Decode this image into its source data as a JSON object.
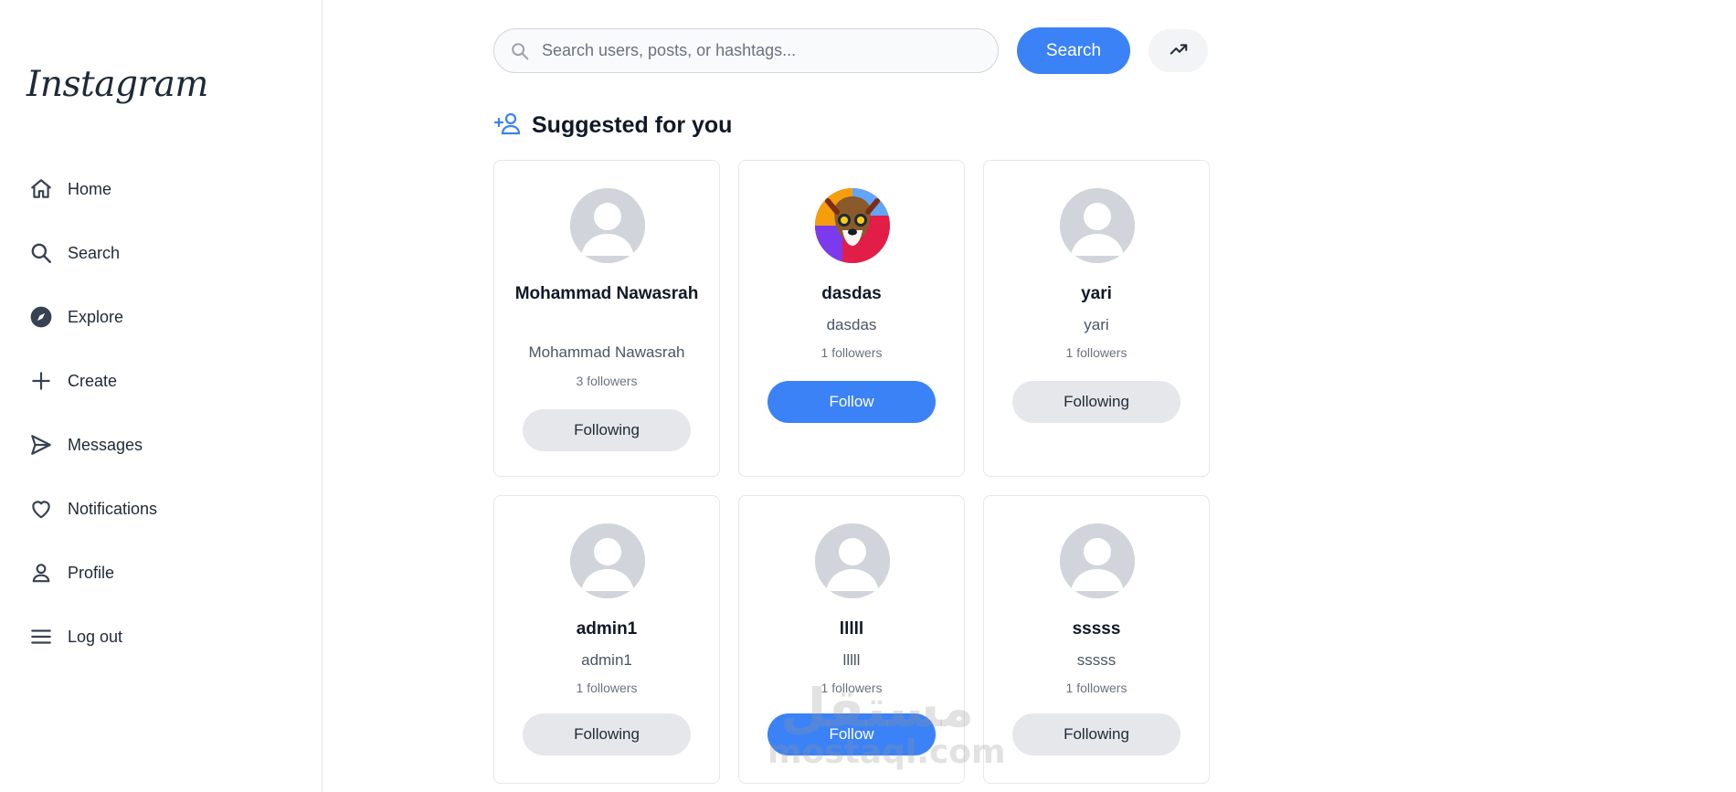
{
  "app": {
    "logo_text": "Instagram"
  },
  "sidebar": {
    "items": [
      {
        "label": "Home",
        "icon": "home-icon"
      },
      {
        "label": "Search",
        "icon": "search-icon"
      },
      {
        "label": "Explore",
        "icon": "compass-icon"
      },
      {
        "label": "Create",
        "icon": "plus-icon"
      },
      {
        "label": "Messages",
        "icon": "send-icon"
      },
      {
        "label": "Notifications",
        "icon": "heart-icon"
      },
      {
        "label": "Profile",
        "icon": "user-icon"
      },
      {
        "label": "Log out",
        "icon": "menu-icon"
      }
    ]
  },
  "search": {
    "placeholder": "Search users, posts, or hashtags...",
    "value": "",
    "button_label": "Search",
    "trending_icon": "trending-up-icon"
  },
  "section": {
    "title": "Suggested for you",
    "icon": "user-plus-icon"
  },
  "colors": {
    "accent": "#3b82f6",
    "following_bg": "#e5e7eb",
    "border": "#e5e7eb"
  },
  "suggestions": [
    {
      "username": "Mohammad Nawasrah",
      "full_name": "Mohammad Nawasrah",
      "followers": "3 followers",
      "button": "Following",
      "state": "following",
      "avatar": "default-avatar"
    },
    {
      "username": "dasdas",
      "full_name": "dasdas",
      "followers": "1 followers",
      "button": "Follow",
      "state": "follow",
      "avatar": "dog-avatar"
    },
    {
      "username": "yari",
      "full_name": "yari",
      "followers": "1 followers",
      "button": "Following",
      "state": "following",
      "avatar": "default-avatar"
    },
    {
      "username": "admin1",
      "full_name": "admin1",
      "followers": "1 followers",
      "button": "Following",
      "state": "following",
      "avatar": "default-avatar"
    },
    {
      "username": "lllll",
      "full_name": "lllll",
      "followers": "1 followers",
      "button": "Follow",
      "state": "follow",
      "avatar": "default-avatar"
    },
    {
      "username": "sssss",
      "full_name": "sssss",
      "followers": "1 followers",
      "button": "Following",
      "state": "following",
      "avatar": "default-avatar"
    }
  ],
  "watermark": {
    "arabic": "مستقل",
    "latin": "mostaql.com"
  }
}
